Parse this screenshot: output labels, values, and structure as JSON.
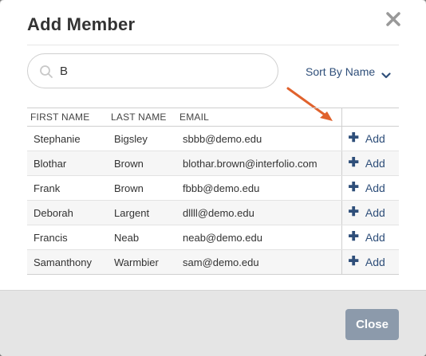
{
  "dialog": {
    "title": "Add Member",
    "close_icon": "close-icon"
  },
  "search": {
    "value": "B",
    "icon": "search-icon"
  },
  "sort": {
    "label": "Sort By Name",
    "icon": "chevron-down-icon"
  },
  "table": {
    "headers": [
      "FIRST NAME",
      "LAST NAME",
      "EMAIL",
      ""
    ],
    "rows": [
      {
        "first": "Stephanie",
        "last": "Bigsley",
        "email": "sbbb@demo.edu",
        "action": "Add"
      },
      {
        "first": "Blothar",
        "last": "Brown",
        "email": "blothar.brown@interfolio.com",
        "action": "Add"
      },
      {
        "first": "Frank",
        "last": "Brown",
        "email": "fbbb@demo.edu",
        "action": "Add"
      },
      {
        "first": "Deborah",
        "last": "Largent",
        "email": "dllll@demo.edu",
        "action": "Add"
      },
      {
        "first": "Francis",
        "last": "Neab",
        "email": "neab@demo.edu",
        "action": "Add"
      },
      {
        "first": "Samanthony",
        "last": "Warmbier",
        "email": "sam@demo.edu",
        "action": "Add"
      }
    ]
  },
  "footer": {
    "close_label": "Close"
  },
  "colors": {
    "link": "#2f4f7a",
    "arrow": "#e0622d",
    "close_button": "#8c9aab"
  }
}
